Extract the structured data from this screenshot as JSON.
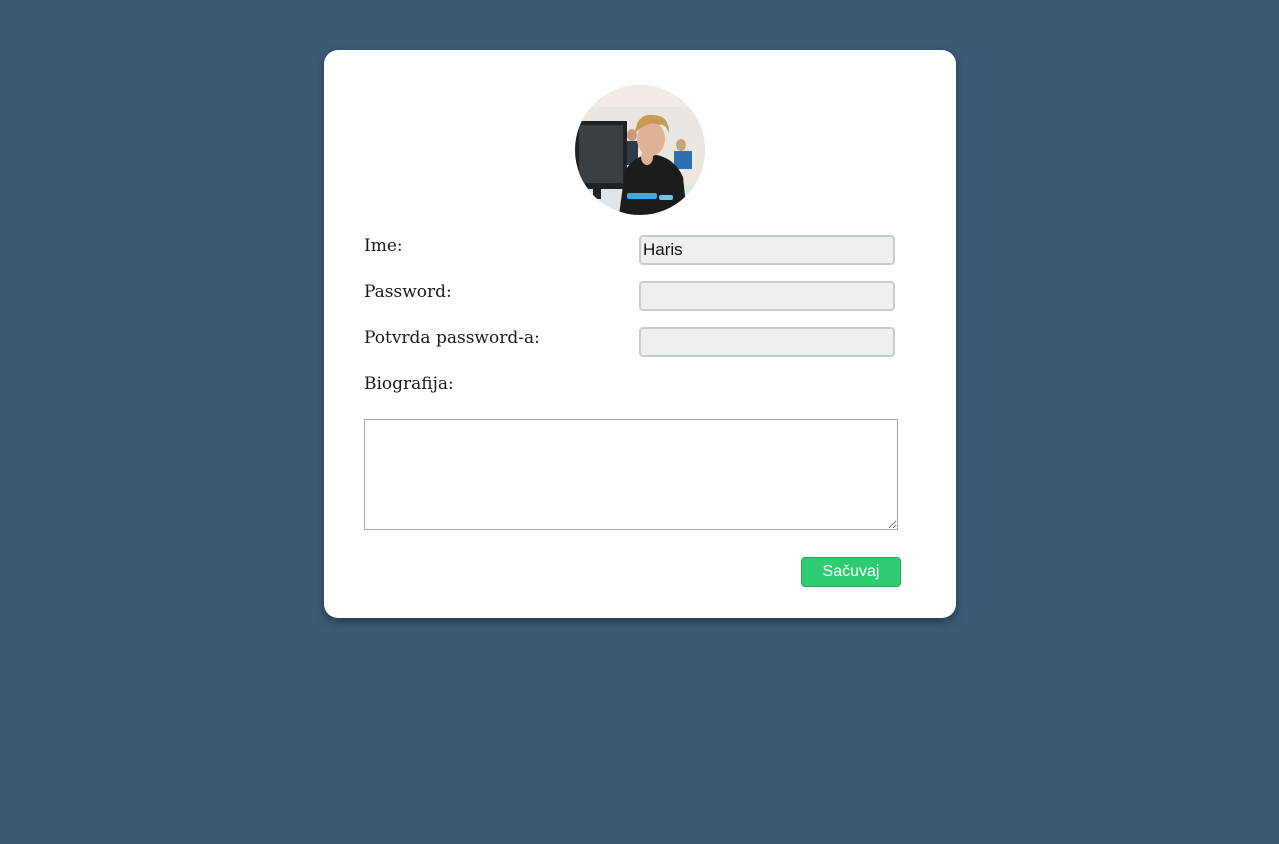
{
  "form": {
    "avatar_icon": "profile-photo",
    "name_label": "Ime:",
    "name_value": "Haris",
    "password_label": "Password:",
    "password_value": "",
    "confirm_label": "Potvrda password-a:",
    "confirm_value": "",
    "bio_label": "Biografija:",
    "bio_value": "",
    "save_label": "Sačuvaj"
  },
  "colors": {
    "background": "#3c5a76",
    "card": "#ffffff",
    "input_bg": "#ecf0f1",
    "save_button": "#2ecc71"
  }
}
